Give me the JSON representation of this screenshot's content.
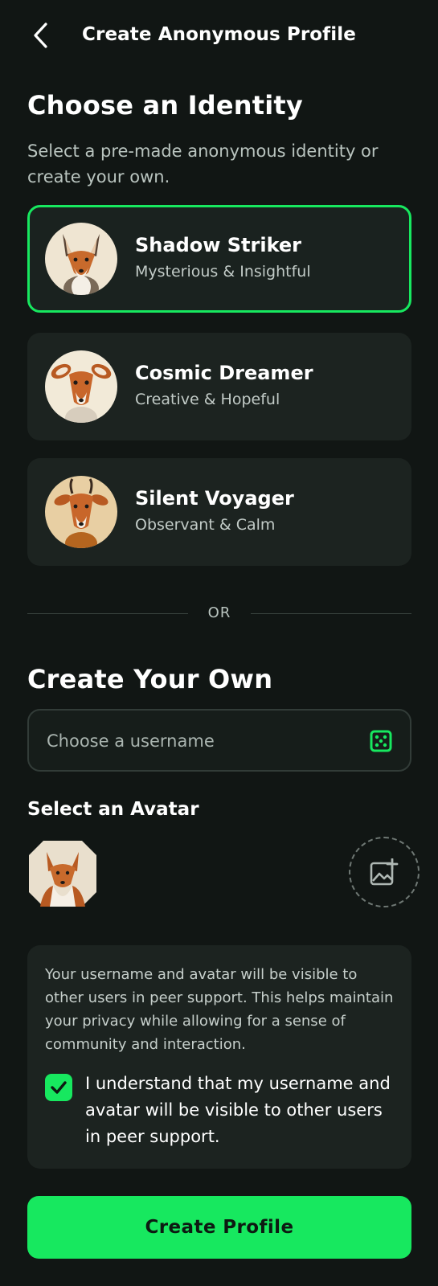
{
  "header": {
    "title": "Create Anonymous Profile",
    "back_icon": "chevron-left-icon"
  },
  "identity_section": {
    "title": "Choose an Identity",
    "subtitle": "Select a pre-made anonymous identity or create your own.",
    "identities": [
      {
        "name": "Shadow Striker",
        "trait": "Mysterious & Insightful",
        "selected": true,
        "avatar_icon": "fox-avatar-icon",
        "avatar_bg": "#efe5d2"
      },
      {
        "name": "Cosmic Dreamer",
        "trait": "Creative & Hopeful",
        "selected": false,
        "avatar_icon": "deer-avatar-icon",
        "avatar_bg": "#f2ead8"
      },
      {
        "name": "Silent Voyager",
        "trait": "Observant & Calm",
        "selected": false,
        "avatar_icon": "antelope-avatar-icon",
        "avatar_bg": "#e8cfa3"
      }
    ]
  },
  "divider": {
    "text": "OR"
  },
  "create_section": {
    "title": "Create Your Own",
    "username_placeholder": "Choose a username",
    "username_value": "",
    "dice_icon": "dice-icon",
    "avatar_label": "Select an Avatar",
    "upload_icon": "add-image-icon"
  },
  "notice": {
    "text": "Your username and avatar will be visible to other users in peer support. This helps maintain your privacy while allowing for a sense of community and interaction.",
    "checkbox_label": "I understand that my username and avatar will be visible to other users in peer support.",
    "checked": true
  },
  "actions": {
    "create_label": "Create Profile"
  },
  "colors": {
    "background": "#111614",
    "card": "#1c2320",
    "accent": "#17e85f",
    "muted_text": "#b9c4bf"
  }
}
